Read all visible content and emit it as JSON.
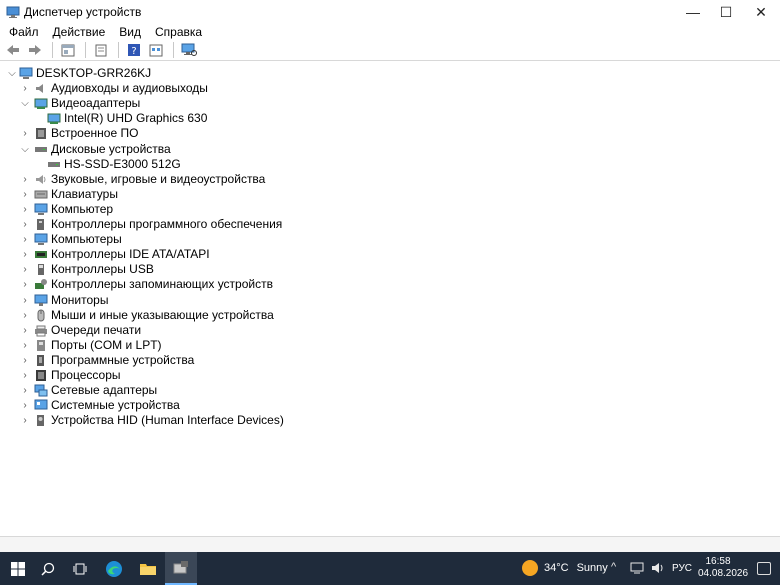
{
  "window": {
    "title": "Диспетчер устройств",
    "controls": {
      "minimize": "—",
      "maximize": "☐",
      "close": "✕"
    }
  },
  "menu": [
    {
      "label": "Файл"
    },
    {
      "label": "Действие"
    },
    {
      "label": "Вид"
    },
    {
      "label": "Справка"
    }
  ],
  "toolbar": {
    "icons": [
      "back-arrow-icon",
      "forward-arrow-icon",
      "properties-icon",
      "driver-icon",
      "help-icon",
      "details-icon",
      "scan-hardware-icon"
    ]
  },
  "tree": {
    "root": "DESKTOP-GRR26KJ",
    "items": [
      {
        "label": "Аудиовходы и аудиовыходы",
        "depth": 1,
        "expand": "collapsed",
        "icon": "audio-icon"
      },
      {
        "label": "Видеоадаптеры",
        "depth": 1,
        "expand": "expanded",
        "icon": "display-adapter-icon"
      },
      {
        "label": "Intel(R) UHD Graphics 630",
        "depth": 2,
        "expand": "none",
        "icon": "display-adapter-icon"
      },
      {
        "label": "Встроенное ПО",
        "depth": 1,
        "expand": "collapsed",
        "icon": "firmware-icon"
      },
      {
        "label": "Дисковые устройства",
        "depth": 1,
        "expand": "expanded",
        "icon": "disk-icon"
      },
      {
        "label": "HS-SSD-E3000 512G",
        "depth": 2,
        "expand": "none",
        "icon": "disk-icon"
      },
      {
        "label": "Звуковые, игровые и видеоустройства",
        "depth": 1,
        "expand": "collapsed",
        "icon": "sound-icon"
      },
      {
        "label": "Клавиатуры",
        "depth": 1,
        "expand": "collapsed",
        "icon": "keyboard-icon"
      },
      {
        "label": "Компьютер",
        "depth": 1,
        "expand": "collapsed",
        "icon": "computer-icon"
      },
      {
        "label": "Контроллеры программного обеспечения",
        "depth": 1,
        "expand": "collapsed",
        "icon": "software-controller-icon"
      },
      {
        "label": "Компьютеры",
        "depth": 1,
        "expand": "collapsed",
        "icon": "computer-icon"
      },
      {
        "label": "Контроллеры IDE ATA/ATAPI",
        "depth": 1,
        "expand": "collapsed",
        "icon": "ide-controller-icon"
      },
      {
        "label": "Контроллеры USB",
        "depth": 1,
        "expand": "collapsed",
        "icon": "usb-icon"
      },
      {
        "label": "Контроллеры запоминающих устройств",
        "depth": 1,
        "expand": "collapsed",
        "icon": "storage-controller-icon"
      },
      {
        "label": "Мониторы",
        "depth": 1,
        "expand": "collapsed",
        "icon": "monitor-icon"
      },
      {
        "label": "Мыши и иные указывающие устройства",
        "depth": 1,
        "expand": "collapsed",
        "icon": "mouse-icon"
      },
      {
        "label": "Очереди печати",
        "depth": 1,
        "expand": "collapsed",
        "icon": "printer-icon"
      },
      {
        "label": "Порты (COM и LPT)",
        "depth": 1,
        "expand": "collapsed",
        "icon": "port-icon"
      },
      {
        "label": "Программные устройства",
        "depth": 1,
        "expand": "collapsed",
        "icon": "software-device-icon"
      },
      {
        "label": "Процессоры",
        "depth": 1,
        "expand": "collapsed",
        "icon": "processor-icon"
      },
      {
        "label": "Сетевые адаптеры",
        "depth": 1,
        "expand": "collapsed",
        "icon": "network-adapter-icon"
      },
      {
        "label": "Системные устройства",
        "depth": 1,
        "expand": "collapsed",
        "icon": "system-device-icon"
      },
      {
        "label": "Устройства HID (Human Interface Devices)",
        "depth": 1,
        "expand": "collapsed",
        "icon": "hid-icon"
      }
    ]
  },
  "taskbar": {
    "weather": {
      "temp": "34°C",
      "condition": "Sunny"
    },
    "language": "РУС",
    "time": "16:58",
    "date": "04.08.2026"
  },
  "colors": {
    "taskbar_bg": "#1f2b3b",
    "accent": "#6fb7ff",
    "sun": "#f5a623"
  }
}
